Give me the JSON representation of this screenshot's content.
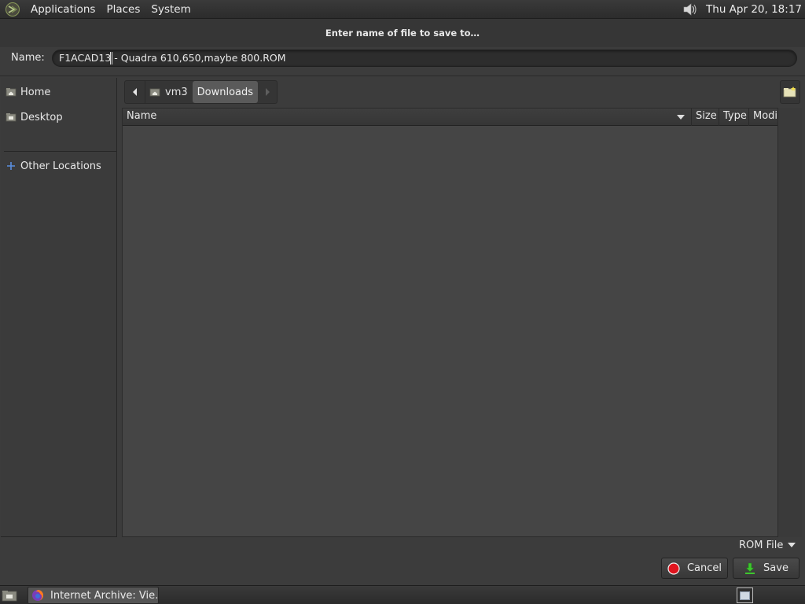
{
  "top_panel": {
    "menus": [
      "Applications",
      "Places",
      "System"
    ],
    "clock": "Thu Apr 20, 18:17"
  },
  "dialog": {
    "title": "Enter name of file to save to…",
    "name_label": "Name:",
    "filename_value": "F1ACAD13 - Quadra 610,650,maybe 800.ROM",
    "sidebar": {
      "items": [
        {
          "label": "Home",
          "icon": "home-folder-icon"
        },
        {
          "label": "Desktop",
          "icon": "desktop-folder-icon"
        },
        {
          "label": "Other Locations",
          "icon": "plus-icon"
        }
      ]
    },
    "path_bar": {
      "segments": [
        "vm3",
        "Downloads"
      ],
      "active": "Downloads"
    },
    "columns": [
      "Name",
      "Size",
      "Type",
      "Modifi"
    ],
    "filter": "ROM File",
    "buttons": {
      "cancel": "Cancel",
      "save": "Save"
    }
  },
  "taskbar": {
    "window_title": "Internet Archive: Vie…"
  },
  "colors": {
    "background": "#3c3c3c",
    "file_list": "#454545",
    "cancel_icon": "#e0141e",
    "save_icon": "#3ec62e"
  }
}
